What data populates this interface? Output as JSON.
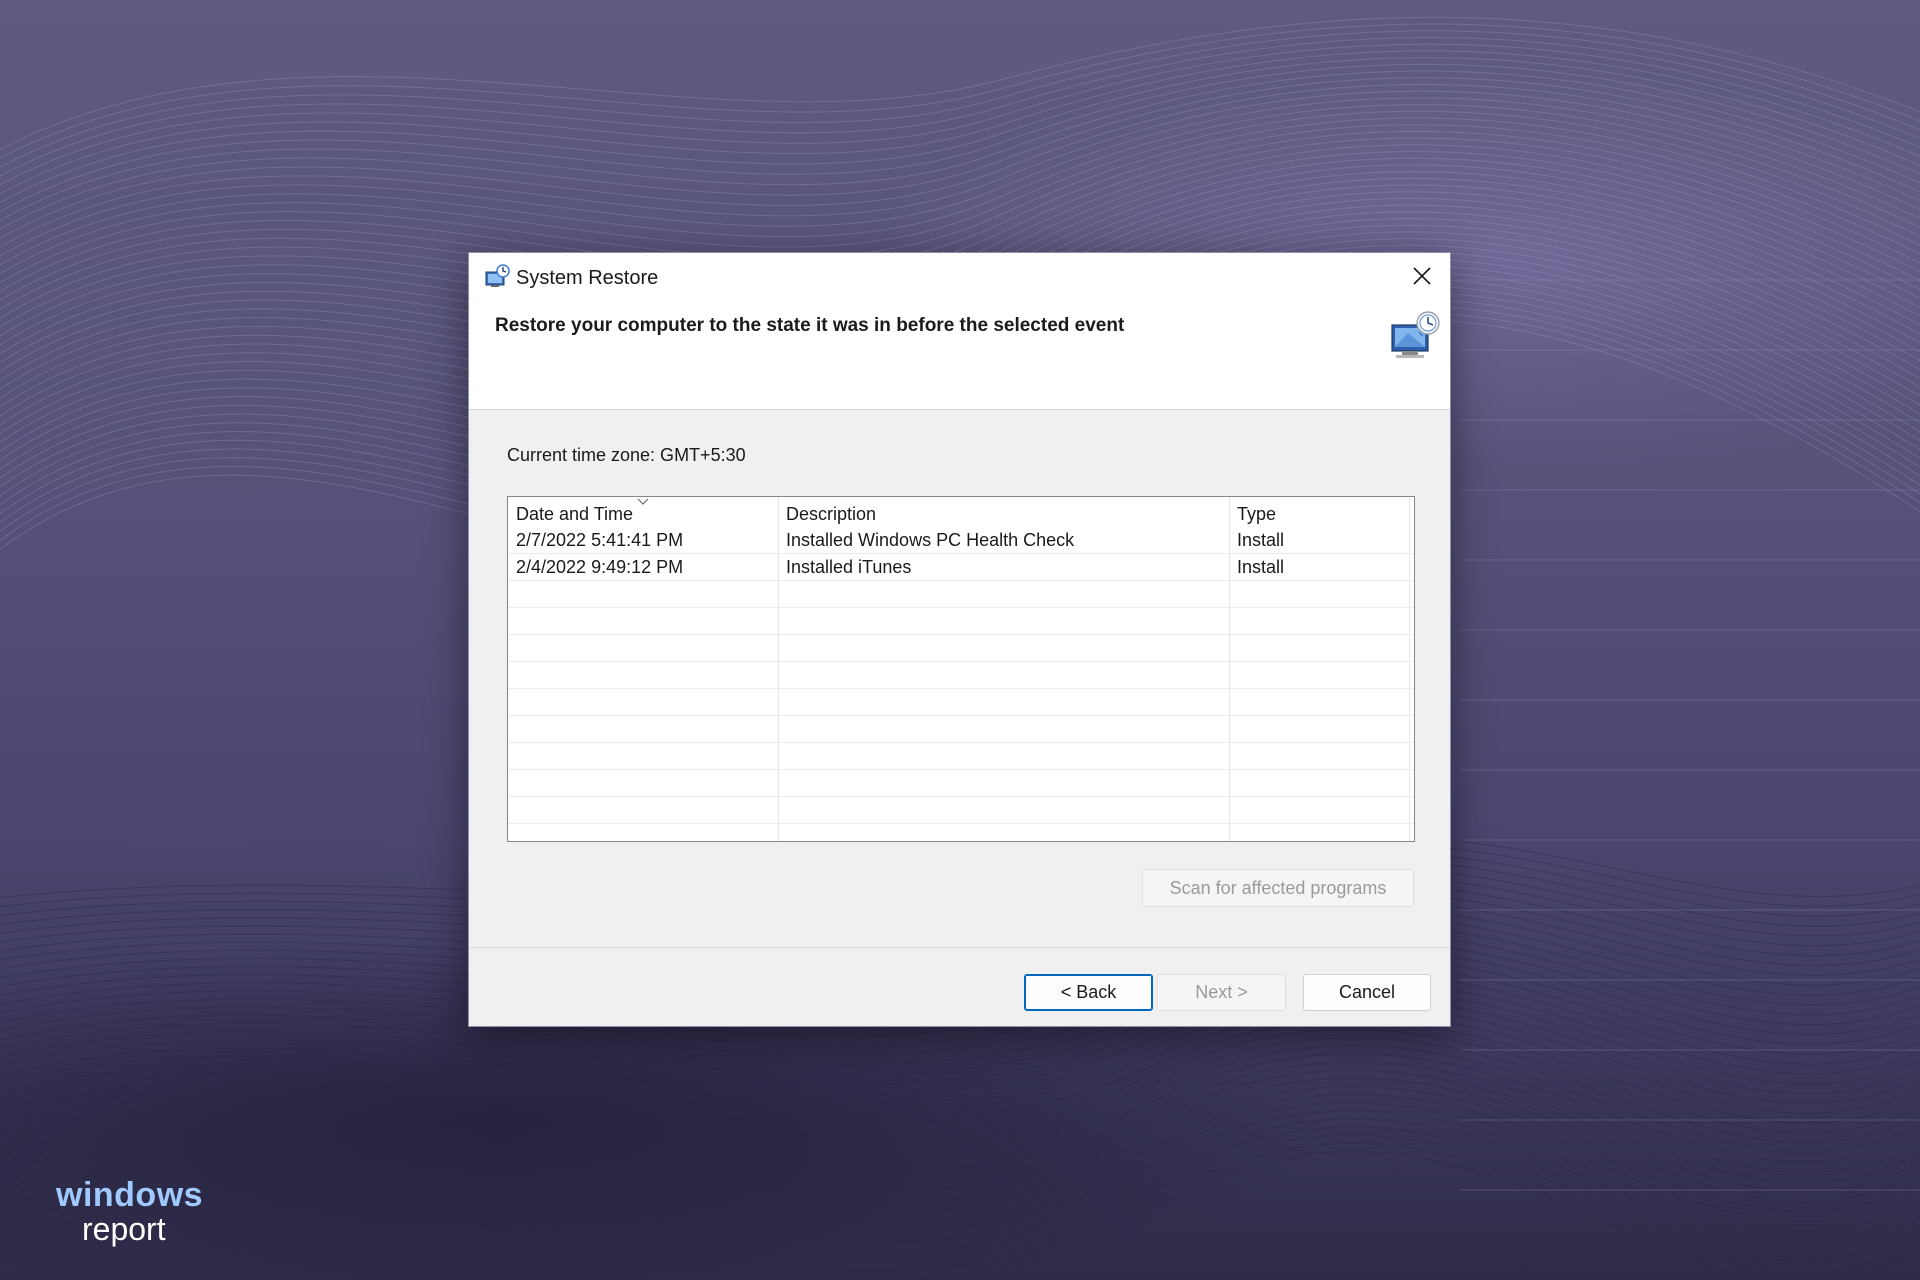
{
  "window": {
    "title": "System Restore",
    "heading": "Restore your computer to the state it was in before the selected event",
    "timezone_label": "Current time zone: GMT+5:30"
  },
  "restore_points": {
    "columns": [
      "Date and Time",
      "Description",
      "Type"
    ],
    "rows": [
      {
        "date": "2/7/2022 5:41:41 PM",
        "description": "Installed Windows PC Health Check",
        "type": "Install"
      },
      {
        "date": "2/4/2022 9:49:12 PM",
        "description": "Installed iTunes",
        "type": "Install"
      }
    ]
  },
  "buttons": {
    "scan": "Scan for affected programs",
    "back": "< Back",
    "next": "Next >",
    "cancel": "Cancel"
  },
  "logo": {
    "line1": "windows",
    "line2": "report"
  },
  "colors": {
    "accent": "#0067c0",
    "logo_blue": "#9fc9ff",
    "background": "#55517a"
  }
}
